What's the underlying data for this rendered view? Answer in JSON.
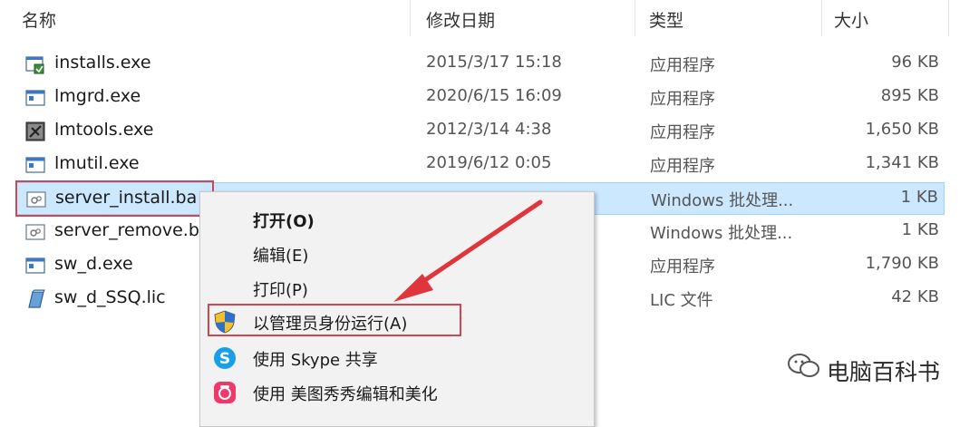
{
  "header": {
    "name": "名称",
    "date": "修改日期",
    "type": "类型",
    "size": "大小"
  },
  "files": [
    {
      "name": "installs.exe",
      "date": "2015/3/17 15:18",
      "type": "应用程序",
      "size": "96 KB",
      "icon": "installer-exe-icon"
    },
    {
      "name": "lmgrd.exe",
      "date": "2020/6/15 16:09",
      "type": "应用程序",
      "size": "895 KB",
      "icon": "window-exe-icon"
    },
    {
      "name": "lmtools.exe",
      "date": "2012/3/14 4:38",
      "type": "应用程序",
      "size": "1,650 KB",
      "icon": "tools-exe-icon"
    },
    {
      "name": "lmutil.exe",
      "date": "2019/6/12 0:05",
      "type": "应用程序",
      "size": "1,341 KB",
      "icon": "window-exe-icon"
    },
    {
      "name": "server_install.ba",
      "date": "",
      "type": "Windows 批处理...",
      "size": "1 KB",
      "icon": "batch-file-icon"
    },
    {
      "name": "server_remove.b",
      "date": "",
      "type": "Windows 批处理...",
      "size": "1 KB",
      "icon": "batch-file-icon"
    },
    {
      "name": "sw_d.exe",
      "date": "",
      "type": "应用程序",
      "size": "1,790 KB",
      "icon": "window-exe-icon"
    },
    {
      "name": "sw_d_SSQ.lic",
      "date": "",
      "type": "LIC 文件",
      "size": "42 KB",
      "icon": "lic-file-icon"
    }
  ],
  "context_menu": {
    "open": "打开(O)",
    "edit": "编辑(E)",
    "print": "打印(P)",
    "run_as_admin": "以管理员身份运行(A)",
    "share_skype": "使用 Skype 共享",
    "edit_meitu": "使用 美图秀秀编辑和美化"
  },
  "watermark": {
    "text": "电脑百科书"
  },
  "colors": {
    "selection": "#cce8ff",
    "highlight_border": "#d0484f",
    "arrow": "#e0363b",
    "menu_bg": "#f2f2f2"
  }
}
